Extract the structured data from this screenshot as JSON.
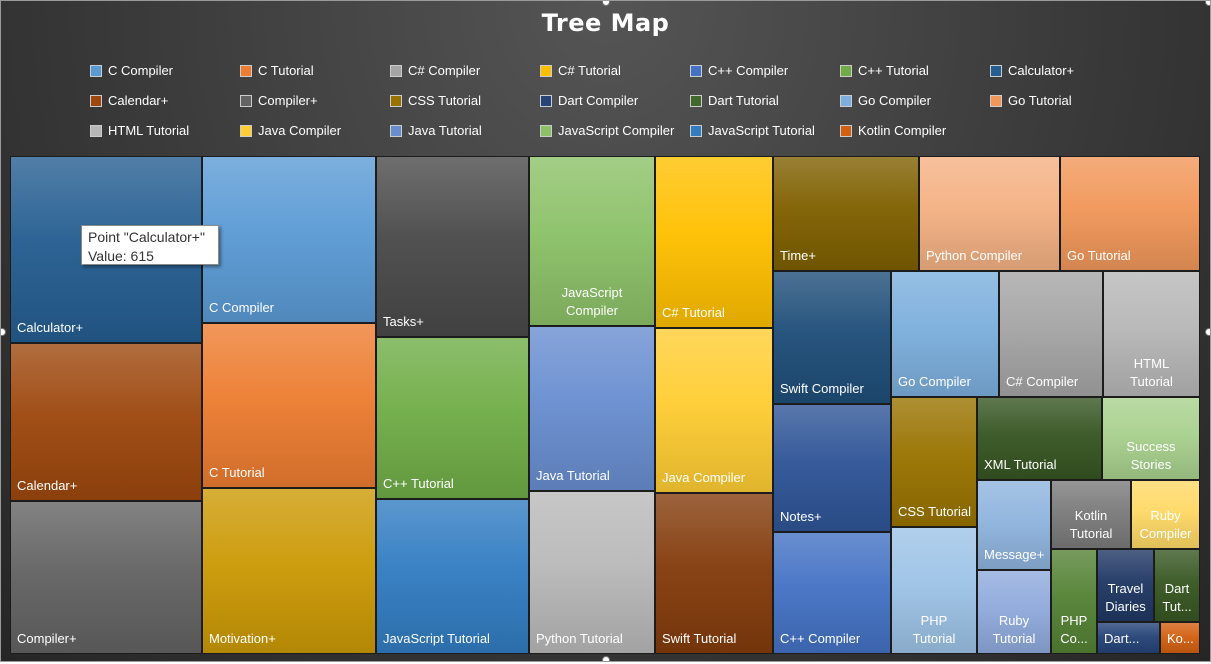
{
  "chart_data": {
    "type": "treemap",
    "title": "Tree Map",
    "legend_position": "top",
    "legend": [
      {
        "name": "C Compiler",
        "color": "#5b9bd5"
      },
      {
        "name": "C Tutorial",
        "color": "#ed7d31"
      },
      {
        "name": "C# Compiler",
        "color": "#a5a5a5"
      },
      {
        "name": "C# Tutorial",
        "color": "#ffc000"
      },
      {
        "name": "C++ Compiler",
        "color": "#4472c4"
      },
      {
        "name": "C++ Tutorial",
        "color": "#70ad47"
      },
      {
        "name": "Calculator+",
        "color": "#255e91"
      },
      {
        "name": "Calendar+",
        "color": "#9e480e"
      },
      {
        "name": "Compiler+",
        "color": "#636363"
      },
      {
        "name": "CSS Tutorial",
        "color": "#997300"
      },
      {
        "name": "Dart Compiler",
        "color": "#264478"
      },
      {
        "name": "Dart Tutorial",
        "color": "#43682b"
      },
      {
        "name": "Go Compiler",
        "color": "#7cafdd"
      },
      {
        "name": "Go Tutorial",
        "color": "#f1975a"
      },
      {
        "name": "HTML Tutorial",
        "color": "#b7b7b7"
      },
      {
        "name": "Java Compiler",
        "color": "#ffcd33"
      },
      {
        "name": "Java Tutorial",
        "color": "#698ed0"
      },
      {
        "name": "JavaScript Compiler",
        "color": "#8cc168"
      },
      {
        "name": "JavaScript Tutorial",
        "color": "#327dc2"
      },
      {
        "name": "Kotlin Compiler",
        "color": "#d26012"
      }
    ],
    "tiles": [
      {
        "label": "Calculator+",
        "color": "#255e91"
      },
      {
        "label": "Calendar+",
        "color": "#9e480e"
      },
      {
        "label": "Compiler+",
        "color": "#636363"
      },
      {
        "label": "C Compiler",
        "color": "#5b9bd5"
      },
      {
        "label": "C Tutorial",
        "color": "#ed7d31"
      },
      {
        "label": "Motivation+",
        "color": "#cc9a06"
      },
      {
        "label": "Tasks+",
        "color": "#4a4a4a"
      },
      {
        "label": "C++ Tutorial",
        "color": "#70ad47"
      },
      {
        "label": "JavaScript Tutorial",
        "color": "#327dc2"
      },
      {
        "label": "JavaScript\nCompiler",
        "color": "#8cc168"
      },
      {
        "label": "Java Tutorial",
        "color": "#698ed0"
      },
      {
        "label": "Python Tutorial",
        "color": "#b9b9b9"
      },
      {
        "label": "C# Tutorial",
        "color": "#ffc000"
      },
      {
        "label": "Java Compiler",
        "color": "#ffcd33"
      },
      {
        "label": "Swift Tutorial",
        "color": "#843c0c"
      },
      {
        "label": "Time+",
        "color": "#7f6000"
      },
      {
        "label": "Python Compiler",
        "color": "#f4b183"
      },
      {
        "label": "Go Tutorial",
        "color": "#f1975a"
      },
      {
        "label": "Swift Compiler",
        "color": "#1f4e79"
      },
      {
        "label": "Notes+",
        "color": "#2f5597"
      },
      {
        "label": "C++ Compiler",
        "color": "#4472c4"
      },
      {
        "label": "Go Compiler",
        "color": "#7cafdd"
      },
      {
        "label": "C# Compiler",
        "color": "#a5a5a5"
      },
      {
        "label": "HTML\nTutorial",
        "color": "#b7b7b7"
      },
      {
        "label": "CSS Tutorial",
        "color": "#997300"
      },
      {
        "label": "XML Tutorial",
        "color": "#375623"
      },
      {
        "label": "Success\nStories",
        "color": "#a9d18e"
      },
      {
        "label": "PHP\nTutorial",
        "color": "#9dc3e6"
      },
      {
        "label": "Message+",
        "color": "#8fb4de"
      },
      {
        "label": "Ruby\nTutorial",
        "color": "#8faadc"
      },
      {
        "label": "Kotlin\nTutorial",
        "color": "#7b7b7b"
      },
      {
        "label": "Ruby\nCompiler",
        "color": "#ffd966"
      },
      {
        "label": "PHP\nCo...",
        "color": "#548235"
      },
      {
        "label": "Travel\nDiaries",
        "color": "#203864"
      },
      {
        "label": "Dart\nTut...",
        "color": "#385723"
      },
      {
        "label": "Dart...",
        "color": "#264478"
      },
      {
        "label": "Ko...",
        "color": "#d26012"
      }
    ]
  },
  "tooltip": {
    "line1": "Point \"Calculator+\"",
    "line2": "Value: 615"
  }
}
